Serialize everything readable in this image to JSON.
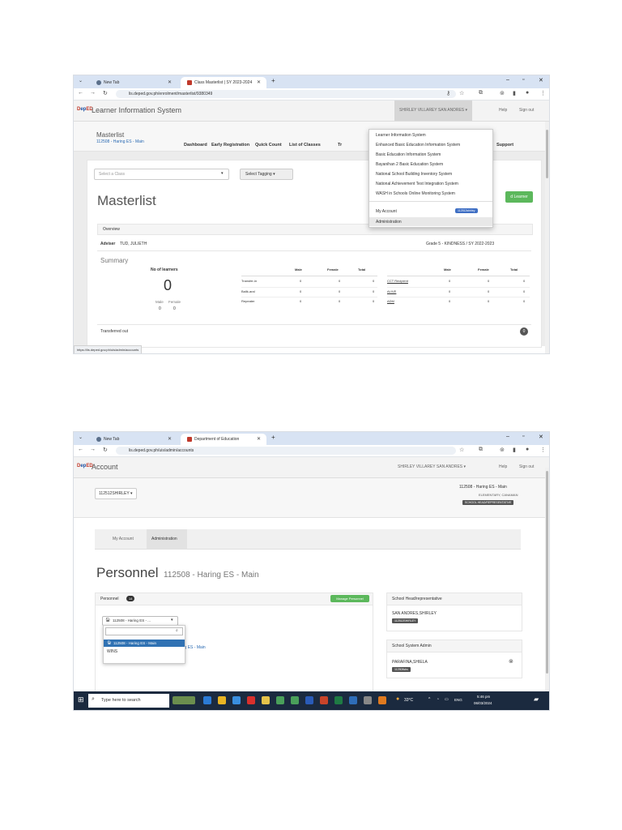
{
  "shot1": {
    "tabs": [
      {
        "label": "New Tab",
        "icon": "globe-icon"
      },
      {
        "label": "Class Masterlist | SY 2023-2024",
        "icon": "deped-favicon"
      }
    ],
    "url": "lis.deped.gov.ph/enrolment/masterlist/9380349",
    "app_title": "Learner Information System",
    "user_menu": "SHIRLEY VILLAREY SAN ANDRES ▾",
    "help": "Help",
    "sign_out": "Sign out",
    "page_heading": "Masterlist",
    "school": "112508 - Haring ES - Main",
    "nav": [
      "Dashboard",
      "Early Registration",
      "Quick Count",
      "List of Classes",
      "Tr",
      "Support"
    ],
    "class_select_placeholder": "Select a Class",
    "tagging_button": "Select Tagging ▾",
    "masterlist_title": "Masterlist",
    "add_learner_button": "d Learner",
    "overview_label": "Overview",
    "adviser_label": "Adviser",
    "adviser_name": "TUD, JULIETH",
    "grade_section": "Grade 5 - KINDNESS / SY 2022-2023",
    "summary_label": "Summary",
    "no_of_learners_label": "No of learners",
    "learner_count": "0",
    "male_label": "Male",
    "female_label": "Female",
    "male_count": "0",
    "female_count": "0",
    "table_headers": [
      "Male",
      "Female",
      "Total"
    ],
    "left_rows": [
      {
        "label": "Transfer-in",
        "male": "0",
        "female": "0",
        "total": "0"
      },
      {
        "label": "Balik-aral",
        "male": "0",
        "female": "0",
        "total": "0"
      },
      {
        "label": "Repeater",
        "male": "0",
        "female": "0",
        "total": "0"
      }
    ],
    "right_rows": [
      {
        "label": "CCT Recipient",
        "male": "0",
        "female": "0",
        "total": "0"
      },
      {
        "label": "ALIVE",
        "male": "0",
        "female": "0",
        "total": "0"
      },
      {
        "label": "ADM",
        "male": "0",
        "female": "0",
        "total": "0"
      }
    ],
    "transferred_out_label": "Transferred out",
    "transferred_out_count": "0",
    "status_url": "https://lis.deped.gov.ph/uis/admin/accounts",
    "dropdown_items": [
      "Learner Information System",
      "Enhanced Basic Education Information System",
      "Basic Education Information System",
      "Bayanihan 2 Basic Education System",
      "National School Building Inventory System",
      "National Achievement Test Integration System",
      "WASH in Schools Online Monitoring System"
    ],
    "my_account": "My Account",
    "my_account_badge": "112512shirley",
    "administration": "Administration"
  },
  "shot2": {
    "tabs": [
      {
        "label": "New Tab",
        "icon": "globe-icon"
      },
      {
        "label": "Department of Education",
        "icon": "deped-favicon"
      }
    ],
    "url": "lis.deped.gov.ph/uis/admin/accounts",
    "app_title": "Account",
    "user_menu": "SHIRLEY VILLAREY SAN ANDRES ▾",
    "help": "Help",
    "sign_out": "Sign out",
    "account_select": "112512SHIRLEY ▾",
    "school_line1": "112508 - Haring ES - Main",
    "school_line2": "ELEMENTARY, CANAMAN",
    "school_badge": "SCHOOL HEAD/REPRESENTATIVE",
    "tab_my_account": "My Account",
    "tab_administration": "Administration",
    "personnel_title": "Personnel",
    "personnel_school": "112508 - Haring ES - Main",
    "personnel_label": "Personnel",
    "personnel_count": "14",
    "manage_button": "Manage Personnel",
    "school_select": "112508 - Haring ES - ...",
    "search_placeholder": "",
    "option_selected": "112508 - Haring ES - Main",
    "option_other": "WINS",
    "behind_text": "ring ES - Main",
    "school_head_title": "School Head/representative",
    "school_head_name": "SAN ANDRES,SHIRLEY",
    "school_head_badge": "112512SHIRLEY",
    "sys_admin_title": "School System Admin",
    "sys_admin_name": "PARAFINA,SHIELA",
    "sys_admin_badge": "112508sbs",
    "taskbar_search": "Type here to search",
    "weather": "33°C",
    "lang": "ENG",
    "time": "5:46 pm",
    "date": "06/03/2024"
  },
  "colors": {
    "tab_strip": "#d8e3f3",
    "green": "#5cb85c",
    "dark_badge": "#555555",
    "selected_option": "#3072b3",
    "badge_blue": "#3f6fc4",
    "taskbar": "#1b2a3f"
  }
}
